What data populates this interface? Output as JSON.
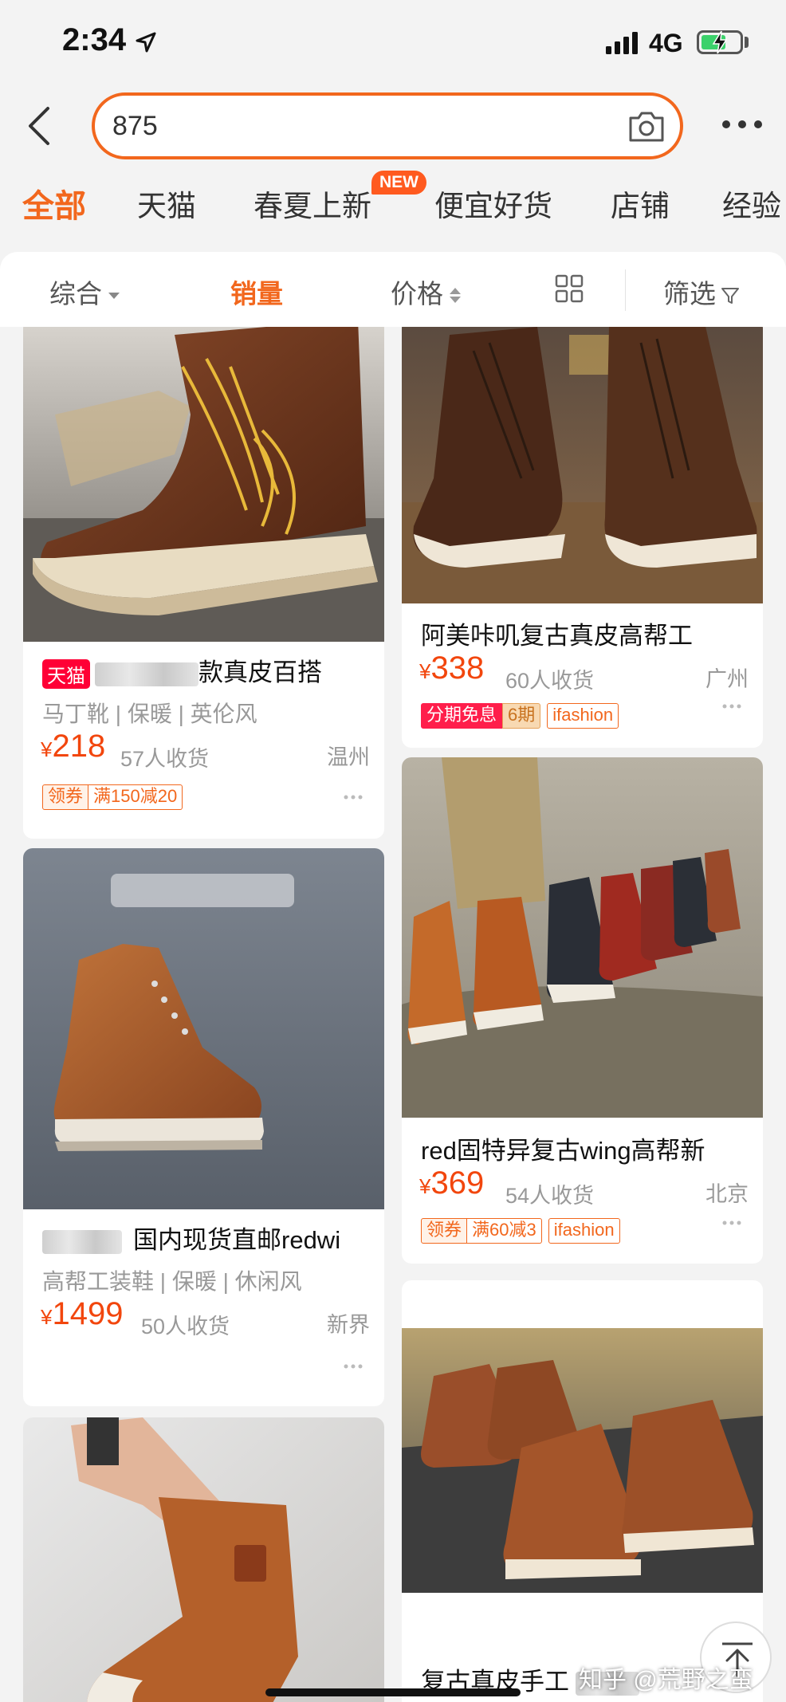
{
  "status_bar": {
    "time": "2:34",
    "network": "4G"
  },
  "search": {
    "value": "875"
  },
  "category_tabs": [
    {
      "label": "全部",
      "active": true
    },
    {
      "label": "天猫"
    },
    {
      "label": "春夏上新",
      "badge": "NEW"
    },
    {
      "label": "便宜好货"
    },
    {
      "label": "店铺"
    },
    {
      "label": "经验"
    }
  ],
  "sort_bar": {
    "overall": "综合",
    "sales": "销量",
    "price": "价格",
    "filter": "筛选"
  },
  "products": [
    {
      "platform_tag": "天猫",
      "title": "款真皮百搭",
      "tags": "马丁靴 | 保暖 | 英伦风",
      "currency": "¥",
      "price": "218",
      "sold": "57人收货",
      "location": "温州",
      "coupon_label": "领券",
      "coupon_value": "满150减20"
    },
    {
      "title": "阿美咔叽复古真皮高帮工",
      "currency": "¥",
      "price": "338",
      "sold": "60人收货",
      "location": "广州",
      "installment_label": "分期免息",
      "installment_periods": "6期",
      "shop_tag": "ifashion"
    },
    {
      "title": "国内现货直邮redwi",
      "tags": "高帮工装鞋 | 保暖 | 休闲风",
      "currency": "¥",
      "price": "1499",
      "sold": "50人收货",
      "location": "新界"
    },
    {
      "title": "red固特异复古wing高帮新",
      "currency": "¥",
      "price": "369",
      "sold": "54人收货",
      "location": "北京",
      "coupon_label": "领券",
      "coupon_value": "满60减3",
      "shop_tag": "ifashion"
    },
    {
      "title": "复古真皮手工"
    }
  ],
  "watermark": "知乎 @荒野之蛮",
  "colors": {
    "accent": "#f2671d",
    "price": "#f2460d",
    "tmall": "#ff0036"
  }
}
